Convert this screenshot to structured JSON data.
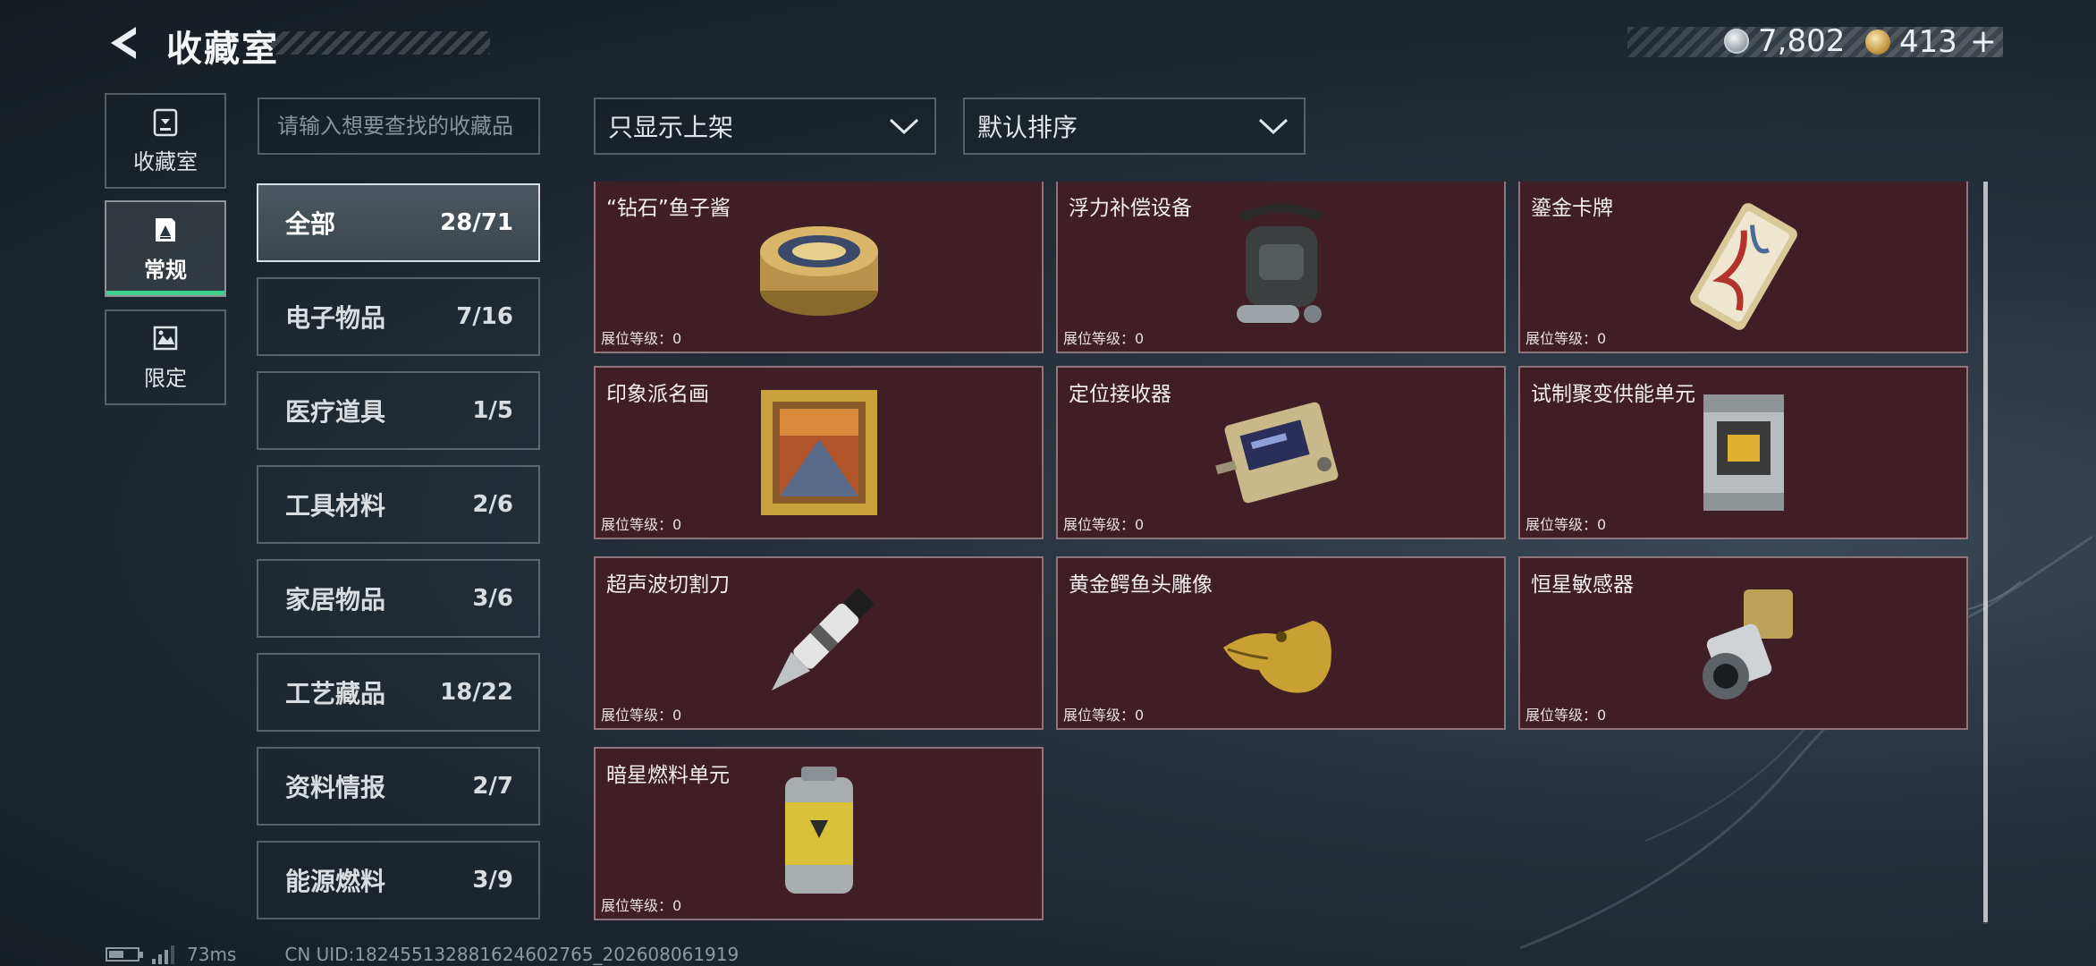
{
  "header": {
    "title": "收藏室",
    "currency_silver": "7,802",
    "currency_gold": "413",
    "plus": "+"
  },
  "side_tabs": [
    {
      "label": "收藏室",
      "icon": "vault-icon"
    },
    {
      "label": "常规",
      "icon": "collection-icon",
      "active": true
    },
    {
      "label": "限定",
      "icon": "limited-icon"
    }
  ],
  "search": {
    "placeholder": "请输入想要查找的收藏品"
  },
  "filters": {
    "show_filter": "只显示上架",
    "sort": "默认排序"
  },
  "categories": [
    {
      "label": "全部",
      "count": "28/71",
      "active": true
    },
    {
      "label": "电子物品",
      "count": "7/16"
    },
    {
      "label": "医疗道具",
      "count": "1/5"
    },
    {
      "label": "工具材料",
      "count": "2/6"
    },
    {
      "label": "家居物品",
      "count": "3/6"
    },
    {
      "label": "工艺藏品",
      "count": "18/22"
    },
    {
      "label": "资料情报",
      "count": "2/7"
    },
    {
      "label": "能源燃料",
      "count": "3/9"
    }
  ],
  "items": [
    {
      "name": "“钻石”鱼子酱",
      "level": "展位等级：0",
      "art": "caviar-tin-icon"
    },
    {
      "name": "浮力补偿设备",
      "level": "展位等级：0",
      "art": "buoyancy-device-icon"
    },
    {
      "name": "鎏金卡牌",
      "level": "展位等级：0",
      "art": "gilded-card-icon"
    },
    {
      "name": "印象派名画",
      "level": "展位等级：0",
      "art": "framed-painting-icon"
    },
    {
      "name": "定位接收器",
      "level": "展位等级：0",
      "art": "locator-receiver-icon"
    },
    {
      "name": "试制聚变供能单元",
      "level": "展位等级：0",
      "art": "fusion-cell-icon"
    },
    {
      "name": "超声波切割刀",
      "level": "展位等级：0",
      "art": "ultrasonic-knife-icon"
    },
    {
      "name": "黄金鳄鱼头雕像",
      "level": "展位等级：0",
      "art": "golden-crocodile-icon"
    },
    {
      "name": "恒星敏感器",
      "level": "展位等级：0",
      "art": "star-sensor-icon"
    },
    {
      "name": "暗星燃料单元",
      "level": "展位等级：0",
      "art": "fuel-canister-icon"
    }
  ],
  "footer": {
    "ping": "73ms",
    "uid": "CN UID:1824551328816246027­65_202608061919"
  },
  "colors": {
    "card_bg": "#3f1e25",
    "active_tab_underline": "#3fcf8e"
  }
}
